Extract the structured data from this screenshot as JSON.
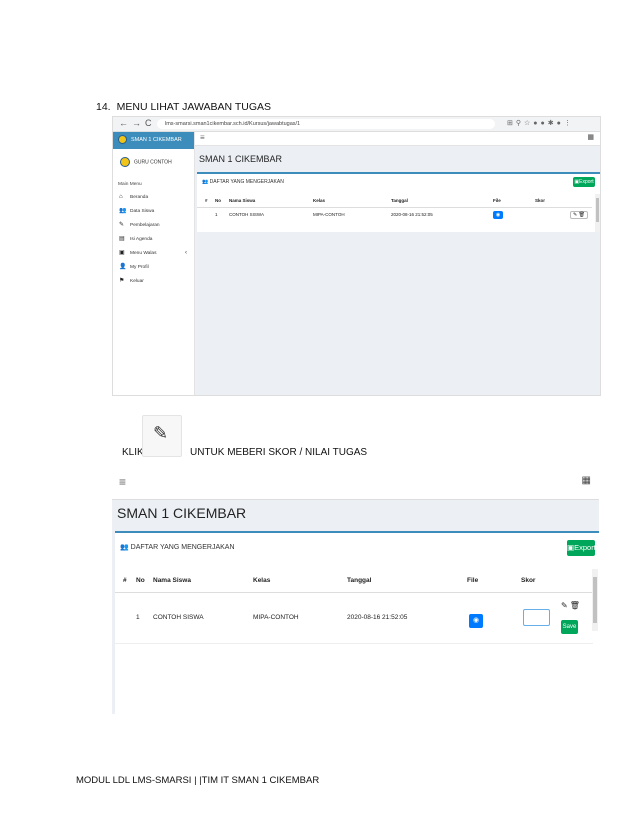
{
  "doc": {
    "section_number": "14.",
    "section_title": "MENU LIHAT JAWABAN TUGAS",
    "klik": "KLIK",
    "instruction": "UNTUK MEBERI SKOR / NILAI TUGAS",
    "footer": "MODUL LDL LMS-SMARSI | |TIM IT SMAN 1 CIKEMBAR"
  },
  "browser": {
    "nav_icons": [
      "back-arrow-icon",
      "forward-arrow-icon",
      "reload-icon"
    ],
    "url": "lms-smarsi.sman1cikembar.sch.id/Kursus/jawabtugas/1"
  },
  "sidebar": {
    "brand": "SMAN 1 CIKEMBAR",
    "user": "GURU CONTOH",
    "menu_title": "Main Menu",
    "items": [
      {
        "label": "Beranda",
        "icon": "home-icon"
      },
      {
        "label": "Data Siswa",
        "icon": "users-icon"
      },
      {
        "label": "Pembelajaran",
        "icon": "edit-icon"
      },
      {
        "label": "Isi Agenda",
        "icon": "clipboard-icon"
      },
      {
        "label": "Menu Walas",
        "icon": "briefcase-icon"
      },
      {
        "label": "My Profil",
        "icon": "user-icon"
      },
      {
        "label": "Keluar",
        "icon": "flag-icon"
      }
    ]
  },
  "page": {
    "title": "SMAN 1 CIKEMBAR",
    "box_title": "DAFTAR YANG MENGERJAKAN",
    "export_label": "Export"
  },
  "table": {
    "headers": [
      "#",
      "No",
      "Nama Siswa",
      "Kelas",
      "Tanggal",
      "File",
      "Skor"
    ],
    "rows": [
      {
        "index": "",
        "no": "1",
        "nama": "CONTOH SISWA",
        "kelas": "MIPA-CONTOH",
        "tanggal": "2020-08-16 21:52:05",
        "skor": ""
      }
    ]
  },
  "zoom": {
    "save_label": "Save",
    "skor_value": ""
  },
  "colors": {
    "primary": "#3c8dbc",
    "success": "#00a65a",
    "file_button": "#007bff",
    "content_bg": "#ecf0f5"
  }
}
